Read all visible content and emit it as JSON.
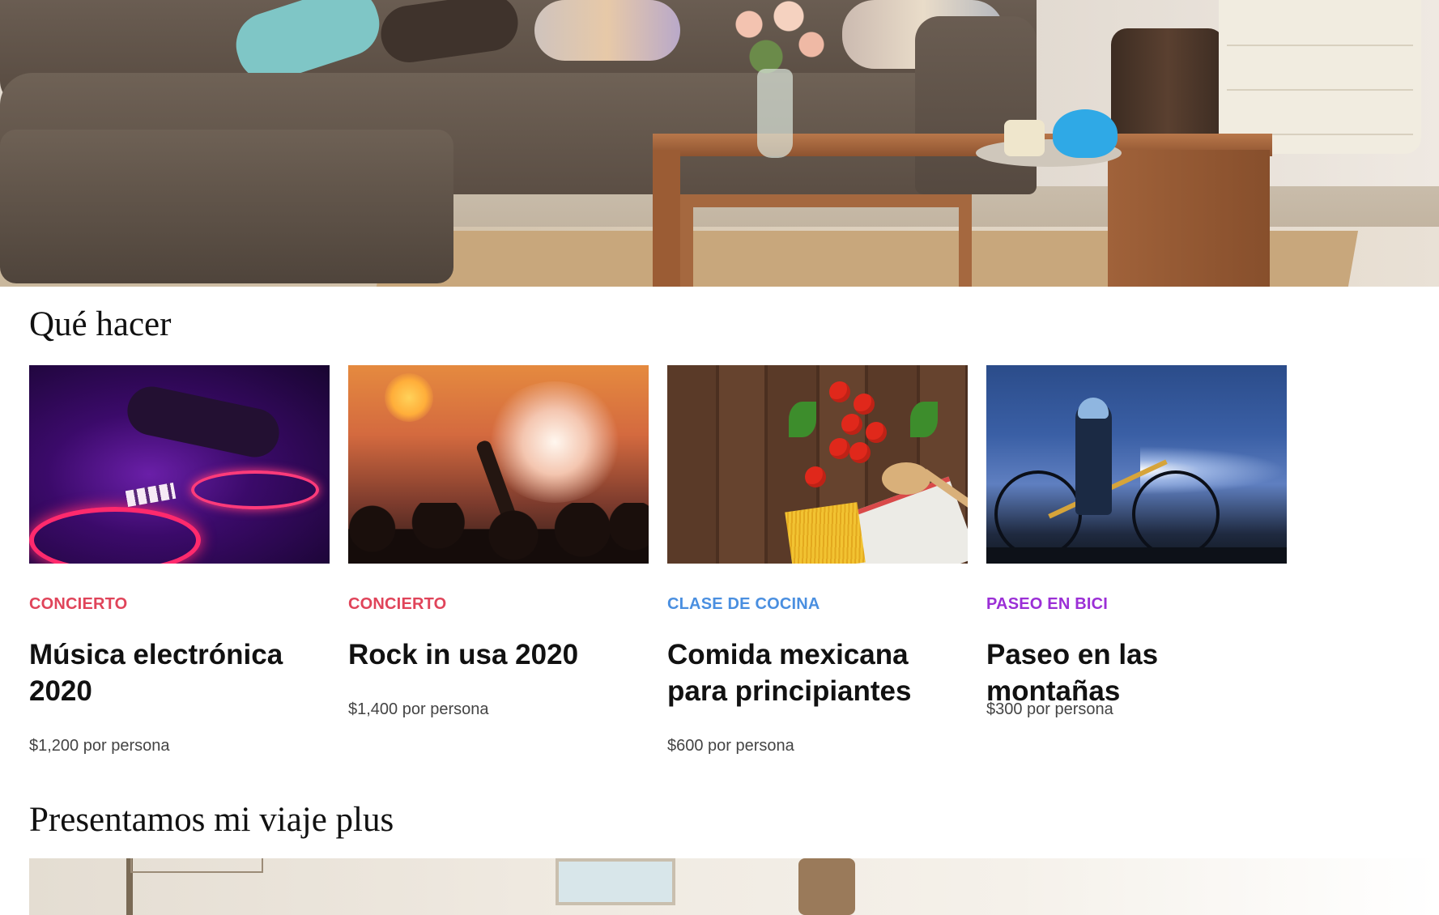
{
  "sections": {
    "what_to_do": "Qué hacer",
    "plus": "Presentamos mi viaje plus"
  },
  "cards": [
    {
      "category": "CONCIERTO",
      "category_color": "#e0445a",
      "title": "Música electrónica 2020",
      "price": "$1,200 por persona"
    },
    {
      "category": "CONCIERTO",
      "category_color": "#e0445a",
      "title": "Rock in usa 2020",
      "price": "$1,400 por persona"
    },
    {
      "category": "CLASE DE COCINA",
      "category_color": "#4a8fe0",
      "title": "Comida mexicana para principiantes",
      "price": "$600 por persona"
    },
    {
      "category": "PASEO EN BICI",
      "category_color": "#9b2fd6",
      "title": "Paseo en las montañas",
      "price": "$300 por persona"
    }
  ]
}
